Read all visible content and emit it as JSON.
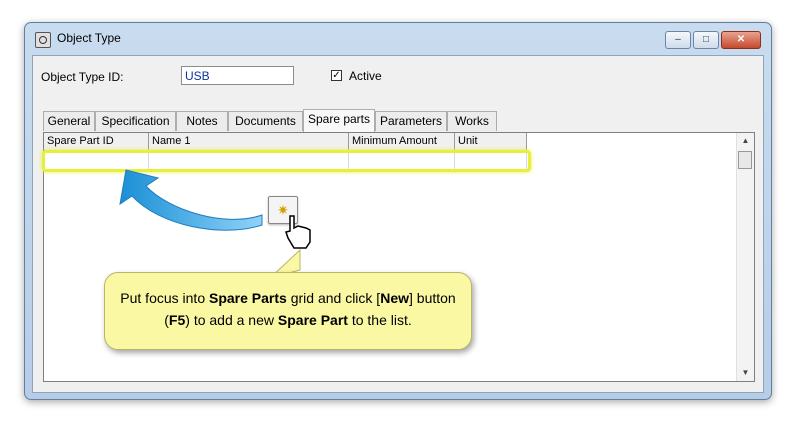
{
  "window": {
    "title": "Object Type",
    "controls": {
      "minimize": "–",
      "maximize": "□",
      "close": "✕"
    }
  },
  "form": {
    "id_label": "Object Type ID:",
    "id_value": "USB",
    "active_label": "Active",
    "active_checked": true,
    "check_mark": "✓"
  },
  "tabs": [
    "General",
    "Specification",
    "Notes",
    "Documents",
    "Spare parts",
    "Parameters",
    "Works"
  ],
  "active_tab": "Spare parts",
  "grid": {
    "columns": [
      "Spare Part ID",
      "Name 1",
      "Minimum Amount",
      "Unit"
    ],
    "scroll_up": "▲",
    "scroll_down": "▼"
  },
  "new_button": {
    "icon": "new-record-icon",
    "glyph": "✷"
  },
  "callout": {
    "part1": "Put focus into ",
    "bold1": "Spare Parts",
    "part2": " grid and click [",
    "bold2": "New",
    "part3": "] button (",
    "bold3": "F5",
    "part4": ") to add a new ",
    "bold4": "Spare Part",
    "part5": " to the list."
  },
  "colors": {
    "highlight": "#e6f03c",
    "callout_bg": "#fbf8a4",
    "arrow": "#2aa6e8"
  }
}
